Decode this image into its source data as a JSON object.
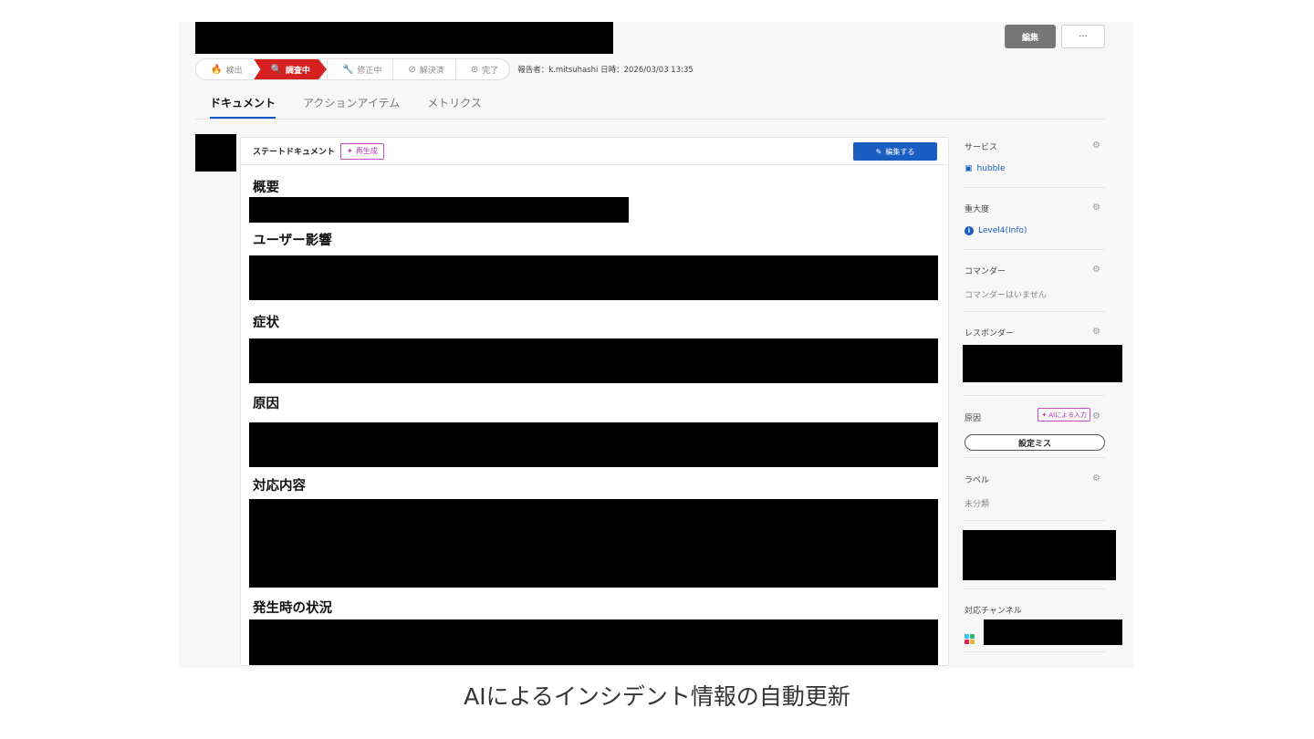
{
  "header": {
    "edit_label": "編集",
    "more_label": "···"
  },
  "status": {
    "steps": [
      {
        "label": "検出",
        "icon": "fire-icon",
        "glyph": "🔥"
      },
      {
        "label": "調査中",
        "icon": "search-icon",
        "glyph": "🔍"
      },
      {
        "label": "修正中",
        "icon": "wrench-icon",
        "glyph": "🔧"
      },
      {
        "label": "解決済",
        "icon": "check-circle-icon",
        "glyph": "⊘"
      },
      {
        "label": "完了",
        "icon": "ban-icon",
        "glyph": "⃠"
      }
    ],
    "active_step": "調査中",
    "active_color": "#d62020",
    "reporter": "報告者：k.mitsuhashi 日時：2026/03/03 13:35"
  },
  "tabs": [
    {
      "label": "ドキュメント",
      "active": true
    },
    {
      "label": "アクションアイテム",
      "active": false
    },
    {
      "label": "メトリクス",
      "active": false
    }
  ],
  "document": {
    "title": "ステートドキュメント",
    "regen_label": "再生成",
    "edit_label": "編集する",
    "sections": [
      "概要",
      "ユーザー影響",
      "症状",
      "原因",
      "対応内容",
      "発生時の状況"
    ]
  },
  "sidebar": {
    "service": {
      "label": "サービス",
      "value": "hubble",
      "icon": "chip-icon"
    },
    "severity": {
      "label": "重大度",
      "value": "Level4(Info)",
      "icon": "info-icon"
    },
    "commander": {
      "label": "コマンダー",
      "value": "コマンダーはいません"
    },
    "responder": {
      "label": "レスポンダー"
    },
    "cause": {
      "label": "原因",
      "ai_label": "AIによる入力",
      "value": "設定ミス"
    },
    "label": {
      "label": "ラベル",
      "value": "未分類"
    },
    "channel": {
      "label": "対応チャンネル",
      "icon": "slack-icon"
    }
  },
  "colors": {
    "accent": "#1a5ec2",
    "ai": "#b238b2",
    "active_step": "#d62020"
  },
  "caption": "AIによるインシデント情報の自動更新"
}
